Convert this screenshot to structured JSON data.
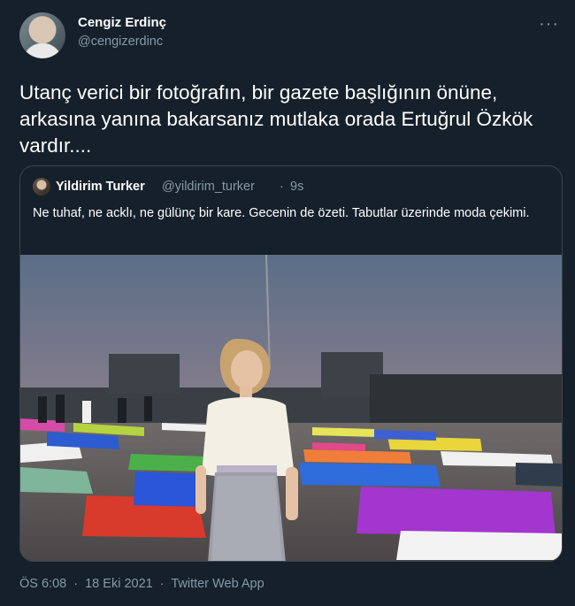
{
  "author": {
    "name": "Cengiz Erdinç",
    "handle": "@cengizerdinc"
  },
  "tweet": {
    "text": "Utanç verici bir fotoğrafın, bir gazete başlığının önüne, arkasına yanına bakarsanız mutlaka orada Ertuğrul Özkök vardır...."
  },
  "quoted": {
    "name": "Yildirim Turker",
    "handle": "@yildirim_turker",
    "dot": "·",
    "time": "9s",
    "text": "Ne tuhaf, ne acklı, ne gülünç bir kare. Gecenin de özeti. Tabutlar üzerinde moda çekimi."
  },
  "footer": {
    "time": "ÖS 6:08",
    "dot1": "·",
    "date": "18 Eki 2021",
    "dot2": "·",
    "source": "Twitter Web App"
  },
  "icons": {
    "more": "more-icon"
  },
  "colors": {
    "background": "#15202b",
    "secondary_text": "#8899a6",
    "border": "#38444d"
  }
}
